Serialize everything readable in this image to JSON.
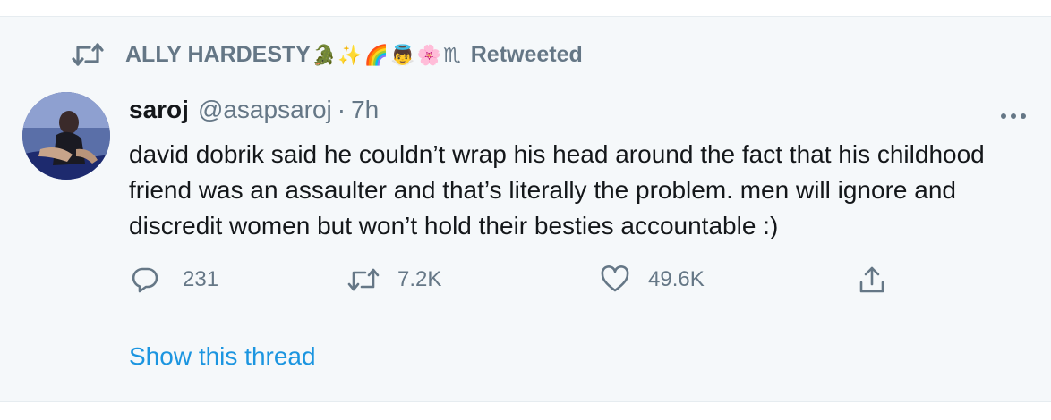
{
  "retweet_context": {
    "user_name": "ALLY HARDESTY",
    "emojis": [
      "🐊",
      "✨",
      "🌈",
      "👼",
      "🌸",
      "♏"
    ],
    "suffix": "Retweeted"
  },
  "tweet": {
    "author_name": "saroj",
    "author_handle": "@asapsaroj",
    "separator": "·",
    "time": "7h",
    "text": "david dobrik said he couldn’t wrap his head around the fact that his childhood friend was an assaulter and that’s literally the problem. men will ignore and discredit women but won’t hold their besties accountable :)"
  },
  "actions": {
    "replies": "231",
    "retweets": "7.2K",
    "likes": "49.6K"
  },
  "show_thread_label": "Show this thread",
  "colors": {
    "background": "#f5f8fa",
    "secondary_text": "#657786",
    "primary_text": "#14171a",
    "link": "#1b95e0"
  }
}
